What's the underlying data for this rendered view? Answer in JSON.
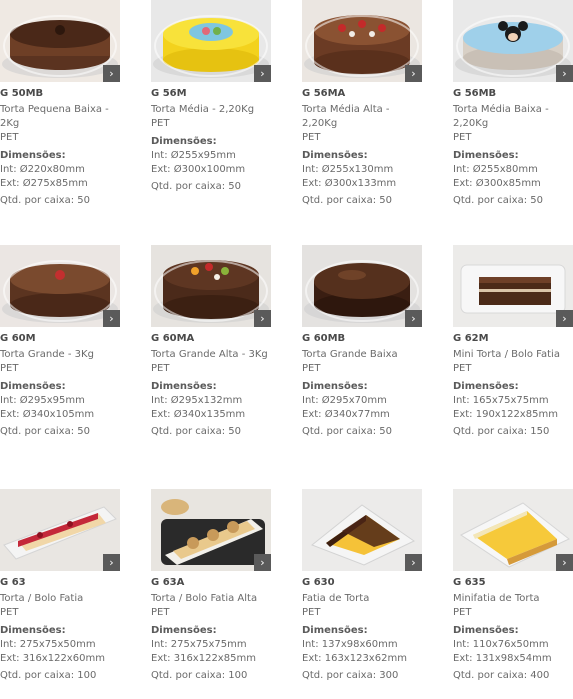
{
  "labels": {
    "dimensions": "Dimensões:",
    "int_prefix": "Int: ",
    "ext_prefix": "Ext: ",
    "qty_prefix": "Qtd. por caixa: ",
    "arrow": "›"
  },
  "products": [
    {
      "code": "G 50MB",
      "name": "Torta Pequena Baixa - 2Kg",
      "material": "PET",
      "int": "Ø220x80mm",
      "ext": "Ø275x85mm",
      "qty": "50",
      "photo": "chocolate-cake-low-dome"
    },
    {
      "code": "G 56M",
      "name": "Torta Média - 2,20Kg",
      "material": "PET",
      "int": "Ø255x95mm",
      "ext": "Ø300x100mm",
      "qty": "50",
      "photo": "yellow-decorated-cake-dome"
    },
    {
      "code": "G 56MA",
      "name": "Torta Média Alta - 2,20Kg",
      "material": "PET",
      "int": "Ø255x130mm",
      "ext": "Ø300x133mm",
      "qty": "50",
      "photo": "chocolate-strawberry-cake-tall-dome"
    },
    {
      "code": "G 56MB",
      "name": "Torta Média Baixa - 2,20Kg",
      "material": "PET",
      "int": "Ø255x80mm",
      "ext": "Ø300x85mm",
      "qty": "50",
      "photo": "mickey-cake-low-dome"
    },
    {
      "code": "G 60M",
      "name": "Torta Grande - 3Kg",
      "material": "PET",
      "int": "Ø295x95mm",
      "ext": "Ø340x105mm",
      "qty": "50",
      "photo": "chocolate-cake-large-dome"
    },
    {
      "code": "G 60MA",
      "name": "Torta Grande Alta - 3Kg",
      "material": "PET",
      "int": "Ø295x132mm",
      "ext": "Ø340x135mm",
      "qty": "50",
      "photo": "fruit-cake-tall-dome"
    },
    {
      "code": "G 60MB",
      "name": "Torta Grande Baixa",
      "material": "PET",
      "int": "Ø295x70mm",
      "ext": "Ø340x77mm",
      "qty": "50",
      "photo": "chocolate-ganache-cake-low-dome"
    },
    {
      "code": "G 62M",
      "name": "Mini Torta / Bolo Fatia",
      "material": "PET",
      "int": "165x75x75mm",
      "ext": "190x122x85mm",
      "qty": "150",
      "photo": "chocolate-slice-box"
    },
    {
      "code": "G 63",
      "name": "Torta / Bolo Fatia",
      "material": "PET",
      "int": "275x75x50mm",
      "ext": "316x122x60mm",
      "qty": "100",
      "photo": "strawberry-log-cake-box"
    },
    {
      "code": "G 63A",
      "name": "Torta / Bolo Fatia Alta",
      "material": "PET",
      "int": "275x75x75mm",
      "ext": "316x122x85mm",
      "qty": "100",
      "photo": "swiss-roll-box"
    },
    {
      "code": "G 630",
      "name": "Fatia de Torta",
      "material": "PET",
      "int": "137x98x60mm",
      "ext": "163x123x62mm",
      "qty": "300",
      "photo": "chocolate-slice-wedge-box"
    },
    {
      "code": "G 635",
      "name": "Minifatia de Torta",
      "material": "PET",
      "int": "110x76x50mm",
      "ext": "131x98x54mm",
      "qty": "400",
      "photo": "yellow-slice-wedge-box"
    }
  ],
  "colors": {
    "arrow_bg": "#5a5a5a",
    "text": "#6a6a6a"
  }
}
